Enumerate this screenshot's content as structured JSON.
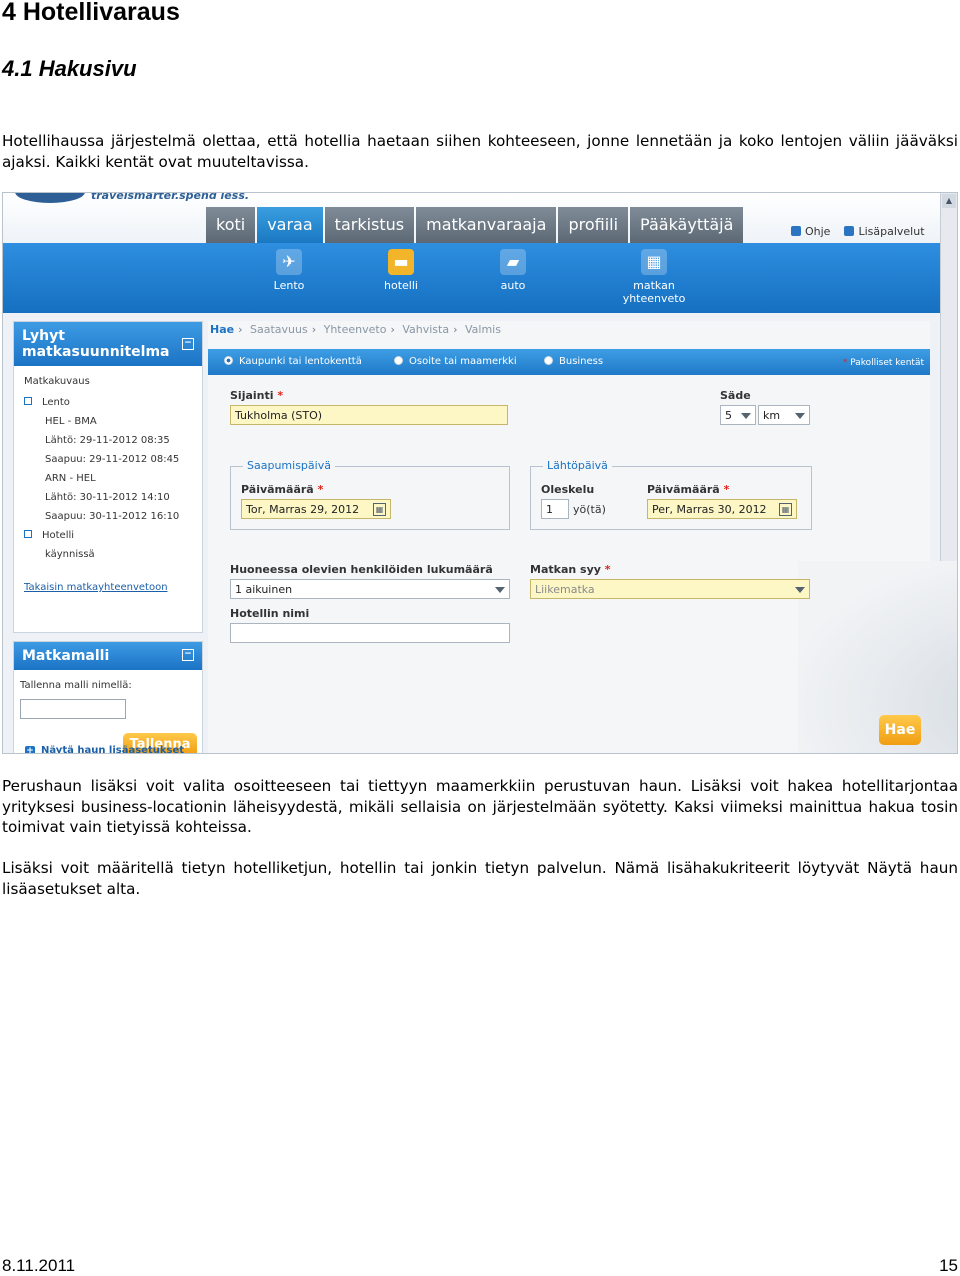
{
  "doc": {
    "h1": "4 Hotellivaraus",
    "h2": "4.1 Hakusivu",
    "p1": "Hotellihaussa järjestelmä olettaa, että hotellia haetaan siihen kohteeseen, jonne lennetään ja koko lentojen väliin jääväksi ajaksi. Kaikki kentät ovat muuteltavissa.",
    "p2": "Perushaun lisäksi voit valita osoitteeseen tai tiettyyn maamerkkiin perustuvan haun. Lisäksi voit hakea hotellitarjontaa yrityksesi business-locationin läheisyydestä, mikäli sellaisia on järjestelmään syötetty. Kaksi viimeksi mainittua hakua tosin toimivat vain tietyissä kohteissa.",
    "p3": "Lisäksi voit määritellä tietyn hotelliketjun, hotellin tai jonkin tietyn palvelun. Nämä lisähakukriteerit löytyvät Näytä haun lisäasetukset alta.",
    "footer_date": "8.11.2011",
    "footer_page": "15"
  },
  "app": {
    "tagline": "travelsmarter.spend less.",
    "nav": [
      "koti",
      "varaa",
      "tarkistus",
      "matkanvaraaja",
      "profiili",
      "Pääkäyttäjä"
    ],
    "top_links": [
      "Ohje",
      "Lisäpalvelut"
    ],
    "subnav": [
      {
        "label": "Lento",
        "icon": "plane-icon",
        "glyph": "✈"
      },
      {
        "label": "hotelli",
        "icon": "hotel-icon",
        "glyph": "▬"
      },
      {
        "label": "auto",
        "icon": "car-icon",
        "glyph": "▰"
      },
      {
        "label": "matkan yhteenveto",
        "icon": "cart-icon",
        "glyph": "▦"
      }
    ],
    "left": {
      "title1": "Lyhyt",
      "title2": "matkasuunnitelma",
      "section": "Matkakuvaus",
      "lento": "Lento",
      "sub": [
        "HEL - BMA",
        "Lähtö: 29-11-2012 08:35",
        "Saapuu: 29-11-2012 08:45",
        "ARN - HEL",
        "Lähtö: 30-11-2012 14:10",
        "Saapuu: 30-11-2012 16:10"
      ],
      "hotelli": "Hotelli",
      "hotelli_sub": "käynnissä",
      "back_link": "Takaisin matkayhteenvetoon",
      "model_title": "Matkamalli",
      "model_label": "Tallenna malli nimellä:",
      "save": "Tallenna"
    },
    "breadcrumb": [
      "Hae",
      "Saatavuus",
      "Yhteenveto",
      "Vahvista",
      "Valmis"
    ],
    "radios": [
      "Kaupunki tai lentokenttä",
      "Osoite tai maamerkki",
      "Business"
    ],
    "required_note": "Pakolliset kentät",
    "sijainti_label": "Sijainti",
    "sijainti_value": "Tukholma (STO)",
    "sade_label": "Säde",
    "sade_value": "5",
    "sade_unit": "km",
    "arrival_group": "Saapumispäivä",
    "arrival_label": "Päivämäärä",
    "arrival_value": "Tor, Marras 29, 2012",
    "departure_group": "Lähtöpäivä",
    "stay_label": "Oleskelu",
    "stay_value": "1",
    "stay_unit": "yö(tä)",
    "departure_label": "Päivämäärä",
    "departure_value": "Per, Marras 30, 2012",
    "persons_label": "Huoneessa olevien henkilöiden lukumäärä",
    "persons_value": "1 aikuinen",
    "reason_label": "Matkan syy",
    "reason_value": "Liikematka",
    "hotel_name_label": "Hotellin nimi",
    "more_options": "Näytä haun lisäasetukset",
    "search": "Hae"
  }
}
